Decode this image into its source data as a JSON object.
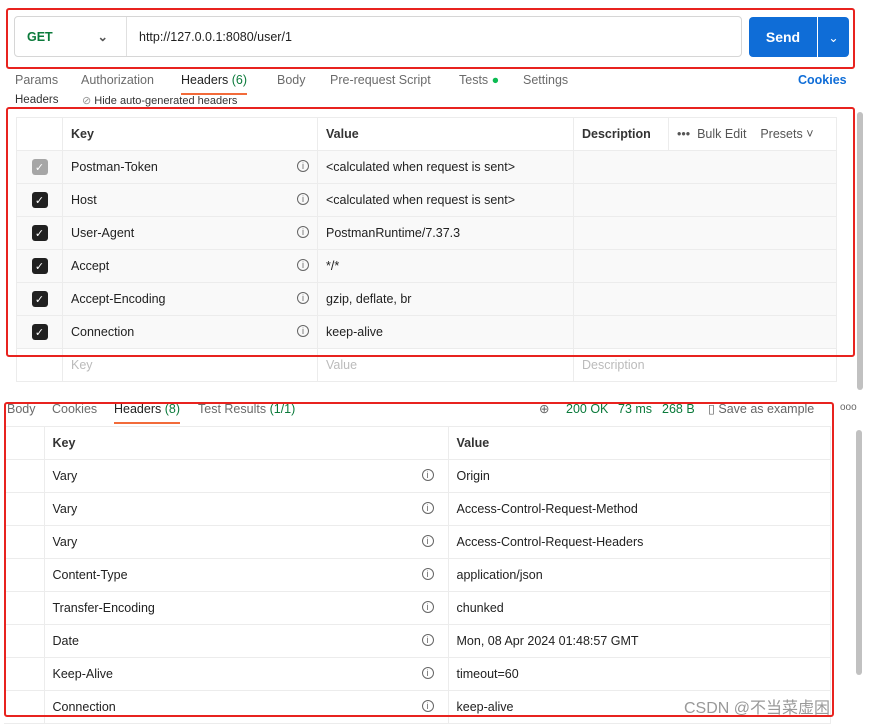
{
  "request": {
    "method": "GET",
    "url": "http://127.0.0.1:8080/user/1",
    "send_label": "Send"
  },
  "req_tabs": [
    {
      "label": "Params"
    },
    {
      "label": "Authorization"
    },
    {
      "label": "Headers",
      "count": "(6)"
    },
    {
      "label": "Body"
    },
    {
      "label": "Pre-request Script"
    },
    {
      "label": "Tests"
    },
    {
      "label": "Settings"
    }
  ],
  "cookies_label": "Cookies",
  "headers_sub": {
    "title": "Headers",
    "hide_label": "Hide auto-generated headers"
  },
  "req_table": {
    "columns": [
      "Key",
      "Value",
      "Description"
    ],
    "bulk_edit": "Bulk Edit",
    "presets": "Presets",
    "rows": [
      {
        "key": "Postman-Token",
        "value": "<calculated when request is sent>",
        "checked": true,
        "disabled": true
      },
      {
        "key": "Host",
        "value": "<calculated when request is sent>",
        "checked": true
      },
      {
        "key": "User-Agent",
        "value": "PostmanRuntime/7.37.3",
        "checked": true
      },
      {
        "key": "Accept",
        "value": "*/*",
        "checked": true
      },
      {
        "key": "Accept-Encoding",
        "value": "gzip, deflate, br",
        "checked": true
      },
      {
        "key": "Connection",
        "value": "keep-alive",
        "checked": true
      }
    ],
    "placeholder": {
      "key": "Key",
      "value": "Value",
      "description": "Description"
    }
  },
  "resp_tabs": [
    {
      "label": "Body"
    },
    {
      "label": "Cookies"
    },
    {
      "label": "Headers",
      "count": "(8)"
    },
    {
      "label": "Test Results",
      "count": "(1/1)"
    }
  ],
  "resp_status": {
    "status": "200 OK",
    "time": "73 ms",
    "size": "268 B",
    "save_label": "Save as example"
  },
  "resp_table": {
    "columns": [
      "Key",
      "Value"
    ],
    "rows": [
      {
        "key": "Vary",
        "value": "Origin"
      },
      {
        "key": "Vary",
        "value": "Access-Control-Request-Method"
      },
      {
        "key": "Vary",
        "value": "Access-Control-Request-Headers"
      },
      {
        "key": "Content-Type",
        "value": "application/json"
      },
      {
        "key": "Transfer-Encoding",
        "value": "chunked"
      },
      {
        "key": "Date",
        "value": "Mon, 08 Apr 2024 01:48:57 GMT"
      },
      {
        "key": "Keep-Alive",
        "value": "timeout=60"
      },
      {
        "key": "Connection",
        "value": "keep-alive"
      }
    ]
  },
  "watermark": "CSDN @不当菜虚困"
}
